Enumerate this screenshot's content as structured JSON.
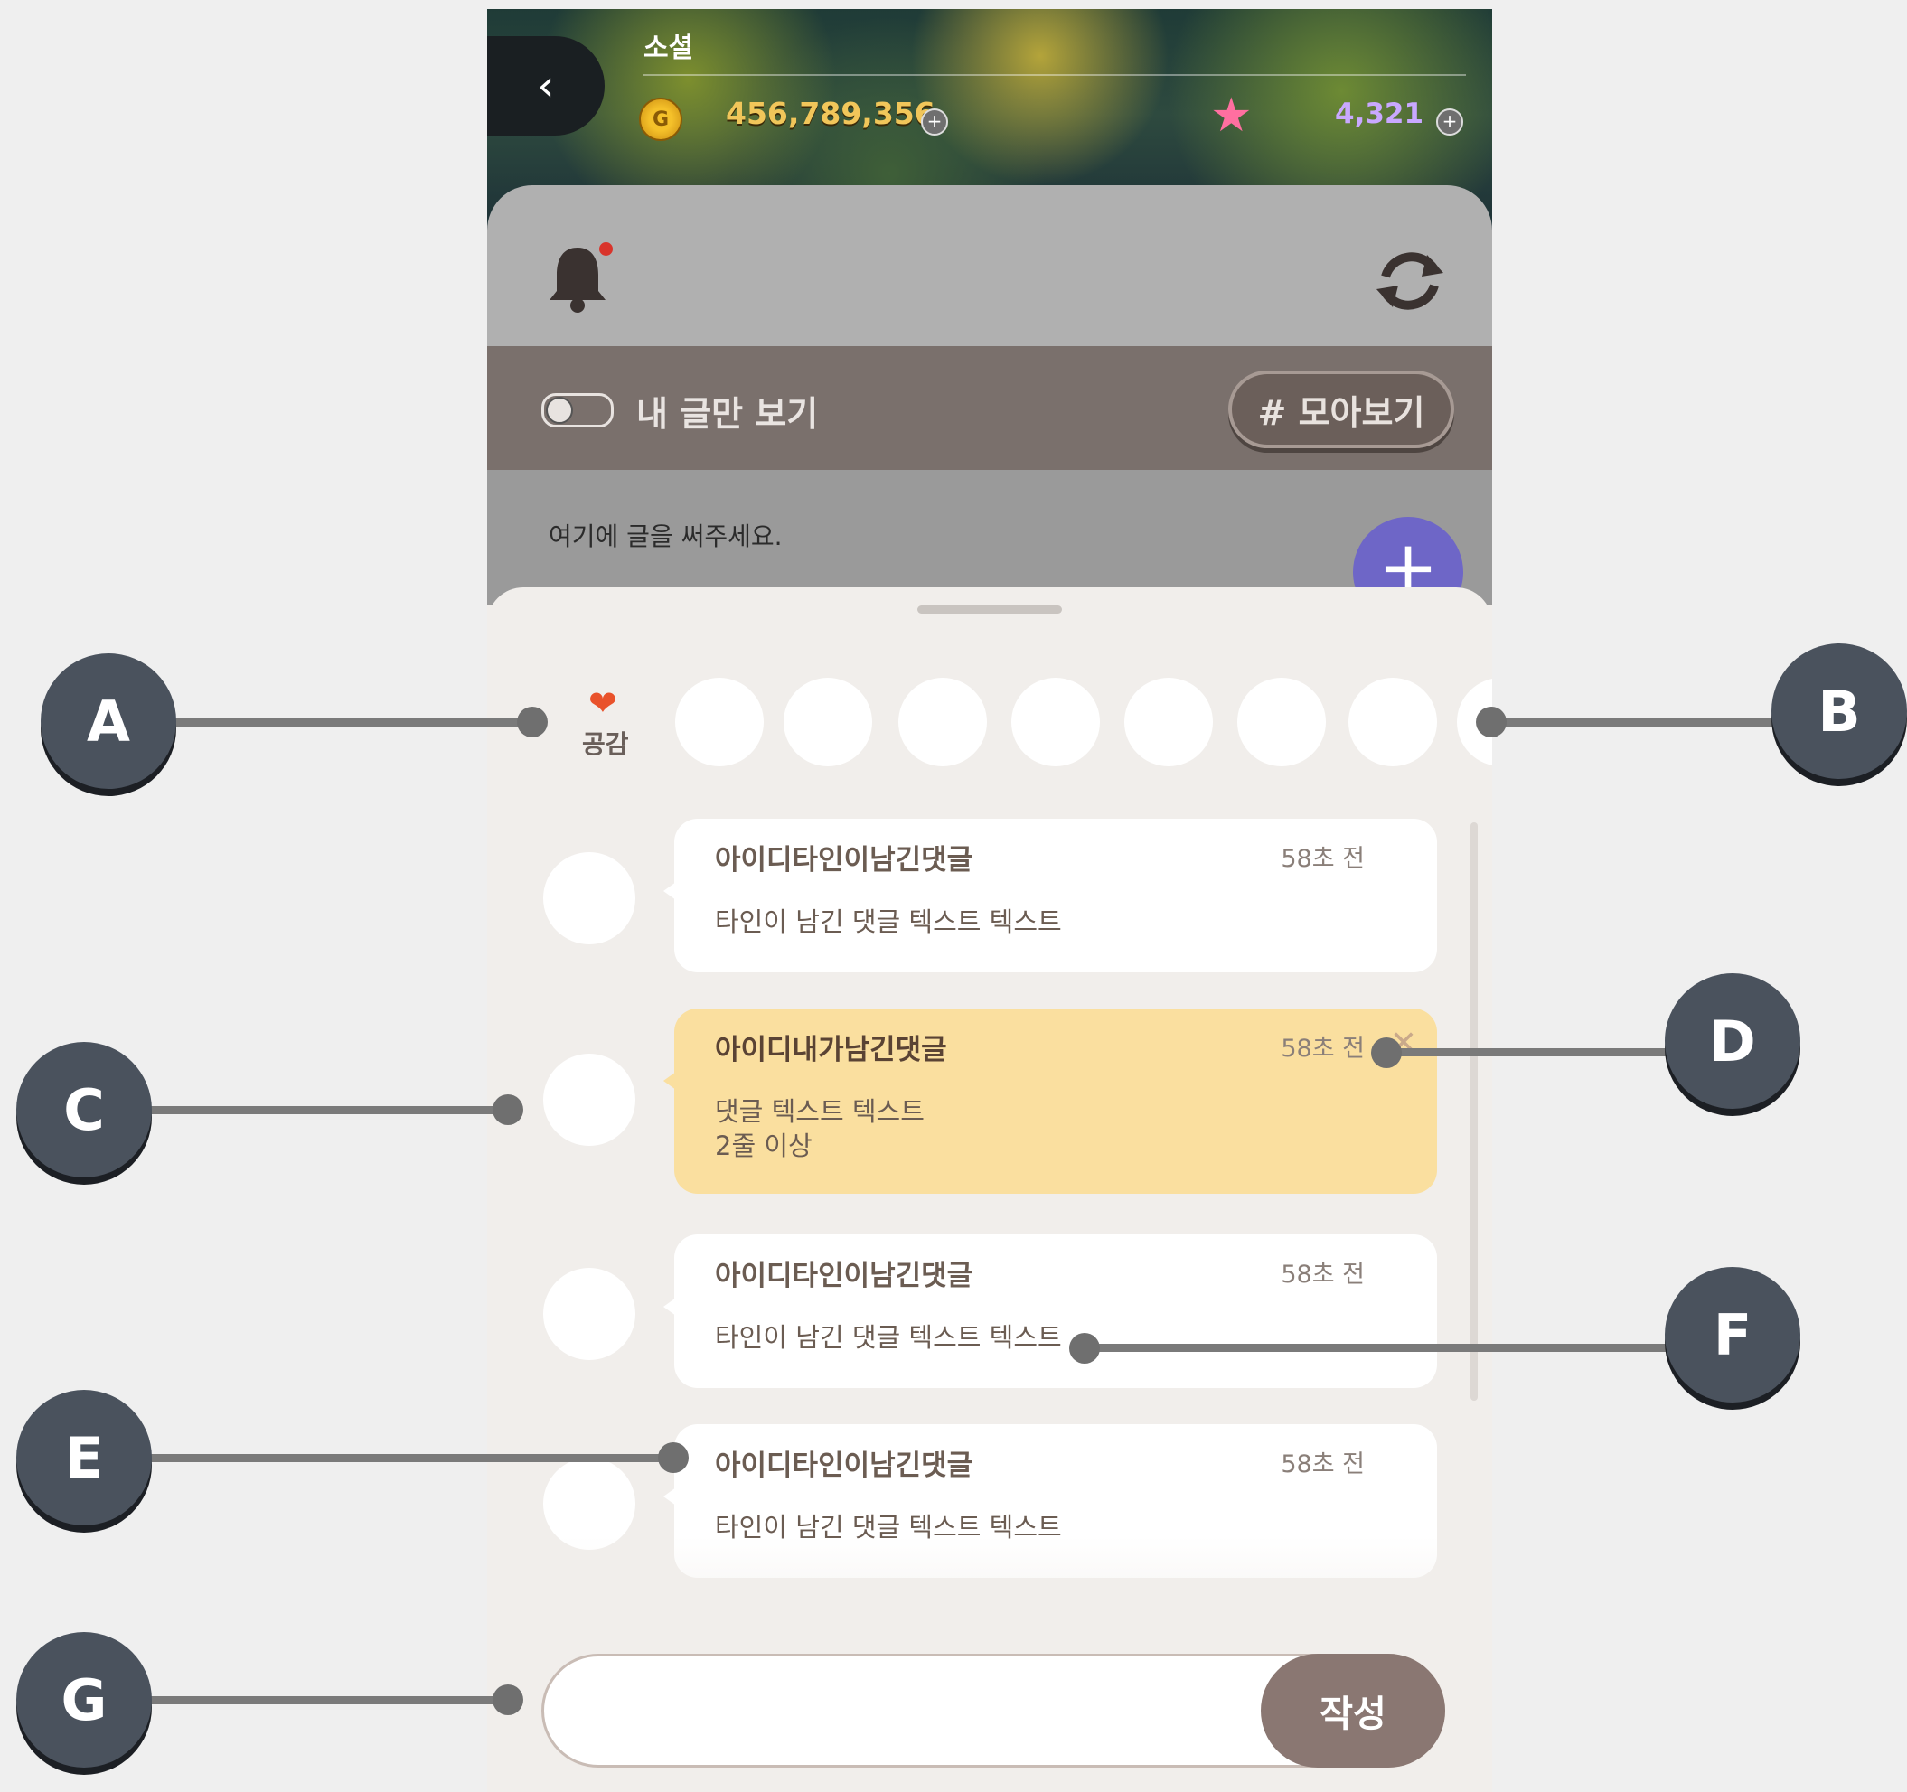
{
  "header": {
    "back_icon": "‹",
    "title": "소셜",
    "gold_amount": "456,789,356",
    "coin_symbol": "G",
    "gem_amount": "4,321",
    "plus": "+"
  },
  "filter": {
    "toggle_label": "내 글만 보기",
    "collect_label": "# 모아보기"
  },
  "composer": {
    "placeholder": "여기에 글을 써주세요.",
    "fab_symbol": "+"
  },
  "reactions": {
    "label": "공감",
    "heart": "❤"
  },
  "comments": [
    {
      "name": "아이디타인이남긴댓글",
      "time": "58초 전",
      "text": "타인이 남긴 댓글 텍스트 텍스트",
      "mine": false
    },
    {
      "name": "아이디내가남긴댓글",
      "time": "58초 전",
      "text": "댓글 텍스트 텍스트\n2줄 이상",
      "mine": true,
      "delete": "✕"
    },
    {
      "name": "아이디타인이남긴댓글",
      "time": "58초 전",
      "text": "타인이 남긴 댓글 텍스트 텍스트",
      "mine": false
    },
    {
      "name": "아이디타인이남긴댓글",
      "time": "58초 전",
      "text": "타인이 남긴 댓글 텍스트 텍스트",
      "mine": false
    }
  ],
  "input": {
    "submit_label": "작성"
  },
  "callouts": {
    "a": "A",
    "b": "B",
    "c": "C",
    "d": "D",
    "e": "E",
    "f": "F",
    "g": "G"
  }
}
